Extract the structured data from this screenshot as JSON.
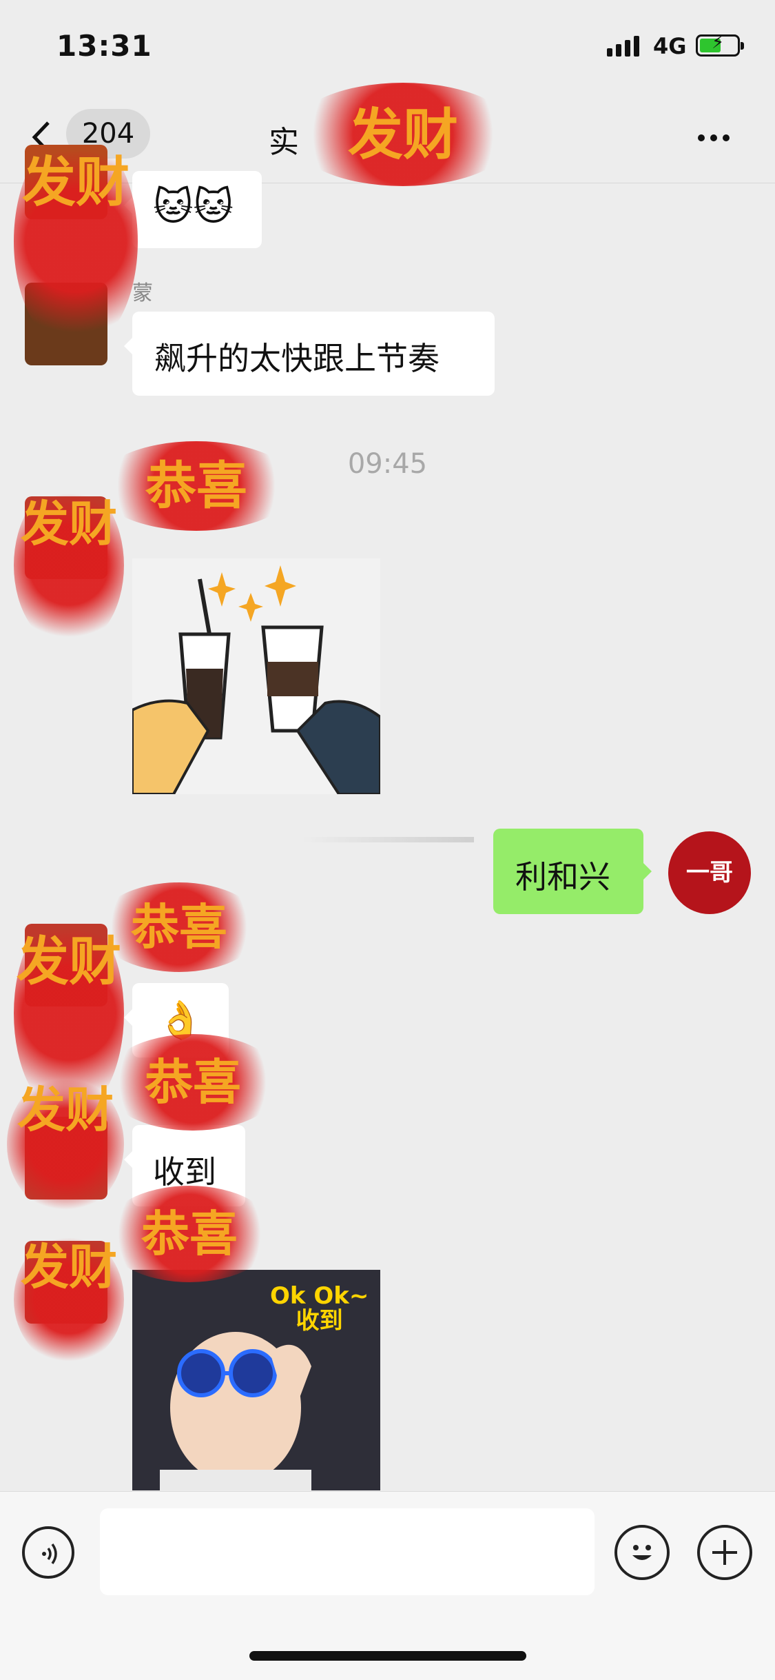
{
  "status_bar": {
    "time": "13:31",
    "network": "4G",
    "battery_charging": true
  },
  "nav": {
    "back_label": "<",
    "unread_count": "204",
    "title": "实",
    "more_label": "···"
  },
  "messages": {
    "m1_sender_partial": "蒙",
    "m2_text": "飙升的太快跟上节奏",
    "timestamp": "09:45",
    "m4_text": "利和兴",
    "m5_emoji": "👌",
    "m6_text": "收到",
    "m7_sticker_text_line1": "Ok Ok~",
    "m7_sticker_text_line2": "收到"
  },
  "self_avatar_text": "一哥",
  "decor_text": {
    "fa_cai": "发财",
    "gong_xi": "恭喜"
  },
  "colors": {
    "self_bubble": "#95ec69",
    "incoming_bubble": "#ffffff",
    "background": "#ededed"
  },
  "icons": [
    "back-icon",
    "more-icon",
    "voice-icon",
    "emoji-icon",
    "plus-icon"
  ]
}
